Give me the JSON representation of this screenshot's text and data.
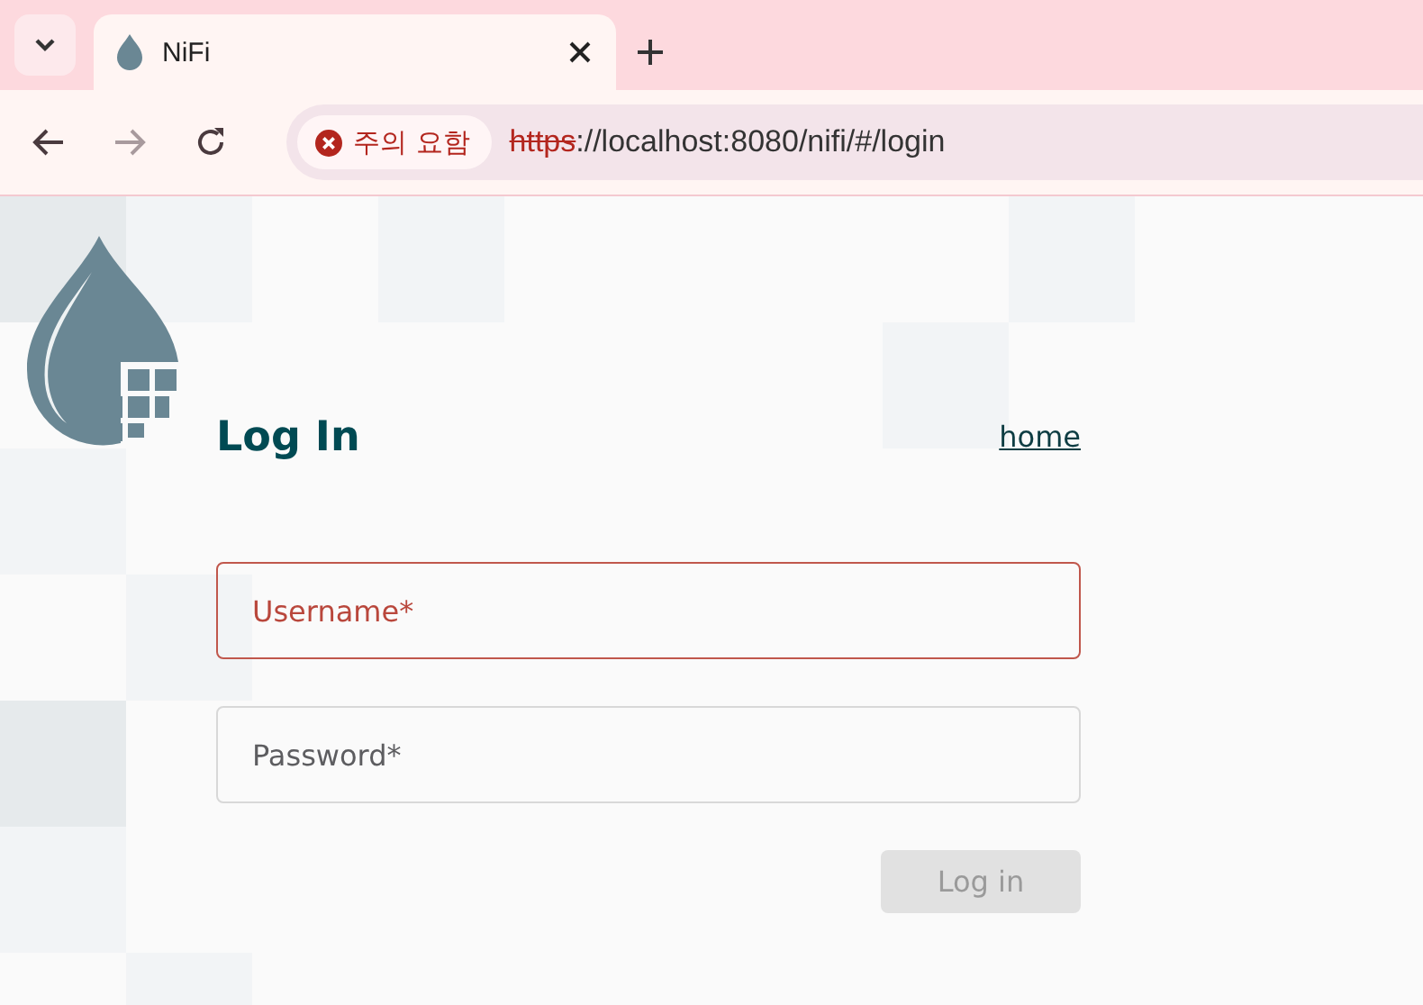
{
  "browser": {
    "tab": {
      "title": "NiFi",
      "selected": true
    },
    "address": {
      "security_label": "주의 요함",
      "scheme": "https",
      "rest": "://localhost:8080/nifi/#/login"
    }
  },
  "page": {
    "heading": "Log In",
    "home_link": "home",
    "fields": [
      {
        "placeholder": "Username*",
        "invalid": true
      },
      {
        "placeholder": "Password*",
        "invalid": false
      }
    ],
    "submit": {
      "label": "Log in",
      "disabled": true
    }
  }
}
